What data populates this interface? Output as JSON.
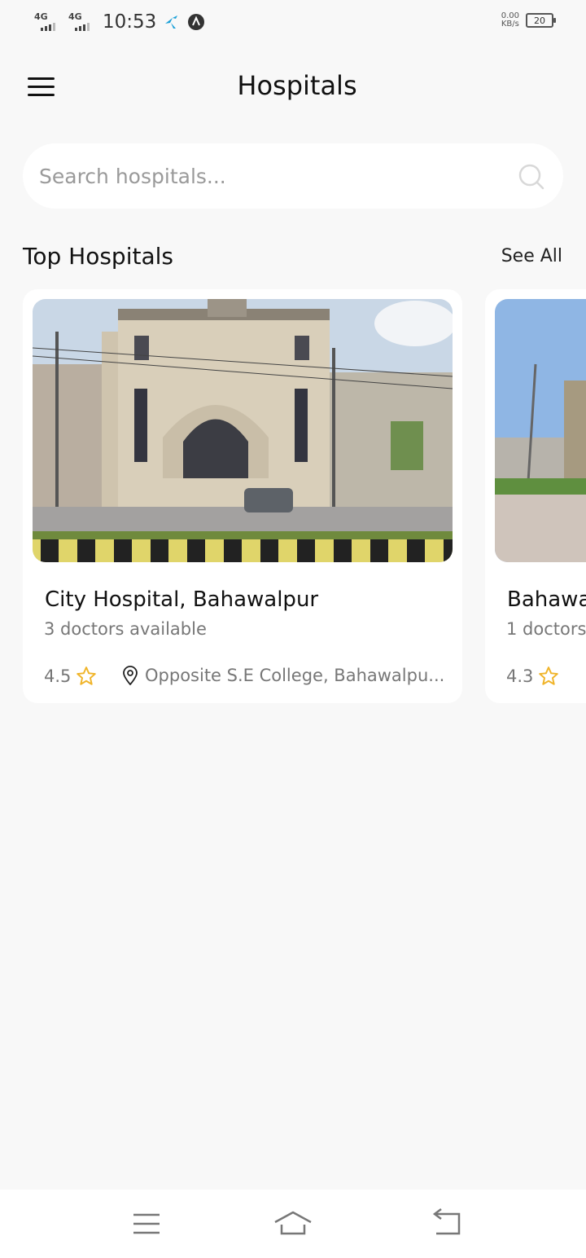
{
  "status_bar": {
    "network_1": "4G",
    "network_2": "4G",
    "time": "10:53",
    "net_speed_value": "0.00",
    "net_speed_unit": "KB/s",
    "battery": "20"
  },
  "header": {
    "title": "Hospitals",
    "menu_icon": "hamburger-menu-icon"
  },
  "search": {
    "placeholder": "Search hospitals...",
    "value": "",
    "icon": "search-icon"
  },
  "section": {
    "title": "Top Hospitals",
    "see_all": "See All"
  },
  "hospitals": [
    {
      "name": "City Hospital, Bahawalpur",
      "doctors": "3 doctors available",
      "rating": "4.5",
      "location": "Opposite S.E College, Bahawalpu..."
    },
    {
      "name": "Bahawa",
      "doctors": "1 doctors",
      "rating": "4.3"
    }
  ],
  "colors": {
    "star": "#f0b429",
    "background": "#f8f8f8",
    "card": "#ffffff"
  },
  "bottom_nav": [
    "menu-icon",
    "home-icon",
    "back-icon"
  ]
}
